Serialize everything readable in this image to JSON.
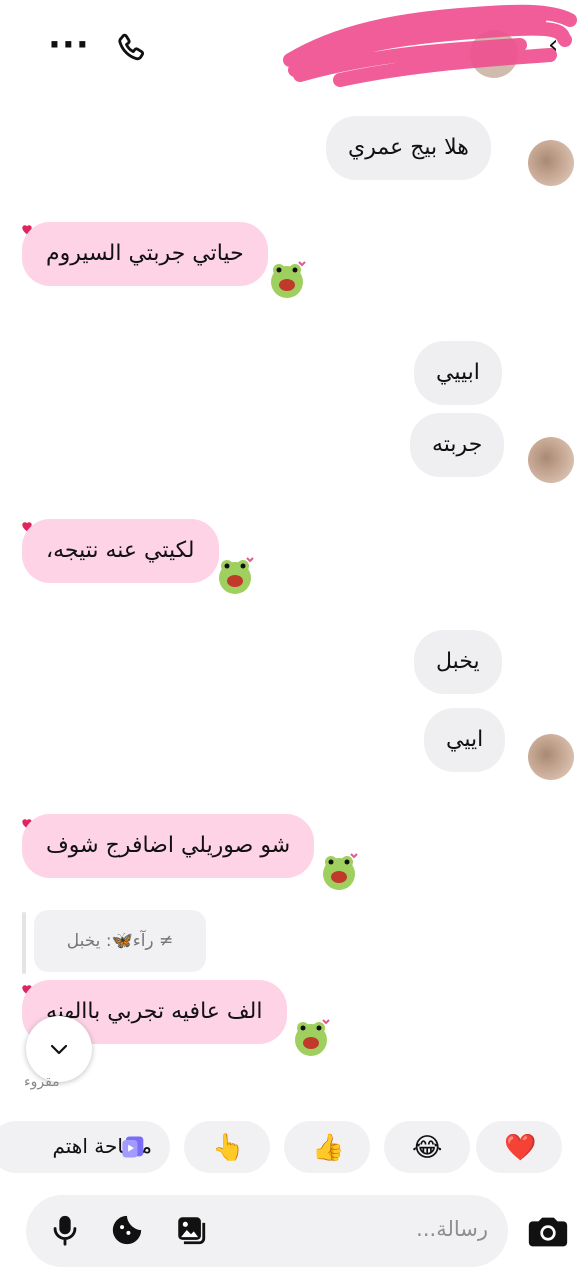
{
  "header": {
    "more_icon": "more-icon",
    "call_icon": "phone-icon",
    "back_glyph": "‹"
  },
  "messages": [
    {
      "text": "هلا بيج عمري",
      "direction": "incoming"
    },
    {
      "text": "حياتي جربتي السيروم",
      "direction": "outgoing"
    },
    {
      "text": "ابييي",
      "direction": "incoming"
    },
    {
      "text": "جربته",
      "direction": "incoming"
    },
    {
      "text": "لكيتي عنه نتيجه،",
      "direction": "outgoing"
    },
    {
      "text": "يخبل",
      "direction": "incoming"
    },
    {
      "text": "اييي",
      "direction": "incoming"
    },
    {
      "text": "شو صوريلي اضافرج شوف",
      "direction": "outgoing"
    },
    {
      "text": "الف عافيه تجربي باالهنه",
      "direction": "outgoing"
    }
  ],
  "reply_preview": {
    "text": "≠ رآء🦋: يخبل"
  },
  "seen_label": "مقروء",
  "quick_reactions": [
    "❤️",
    "😂",
    "👍",
    "👆"
  ],
  "quick_action": {
    "label": "مساحة اهتم"
  },
  "composer": {
    "placeholder": "رسالة..."
  },
  "colors": {
    "outgoing_bubble": "#fdd3e5",
    "incoming_bubble": "#efeff1",
    "scribble": "#ef4f8f"
  }
}
